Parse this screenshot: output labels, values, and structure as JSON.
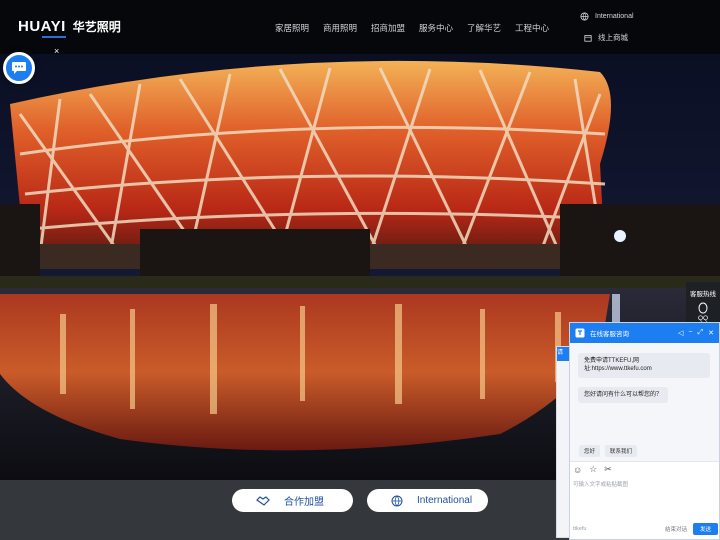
{
  "header": {
    "logo_latin": "HUAYI",
    "logo_cn": "华艺照明",
    "nav": [
      {
        "label": "家居照明"
      },
      {
        "label": "商用照明"
      },
      {
        "label": "招商加盟"
      },
      {
        "label": "服务中心"
      },
      {
        "label": "了解华艺"
      },
      {
        "label": "工程中心"
      }
    ],
    "international": "International",
    "shop": "线上商城"
  },
  "hero": {
    "close_mark": "×"
  },
  "bottom": {
    "join_label": "合作加盟",
    "intl_label": "International"
  },
  "side": {
    "hotline": "客服热线",
    "qq": "QQ"
  },
  "chat": {
    "title": "在线客服咨询",
    "welcome": "免费申请TTKEFU,网址:https://www.ttkefu.com",
    "greeting": "您好请问有什么可以帮您的？",
    "quick_replies": [
      "您好",
      "联系我们"
    ],
    "input_placeholder": "可输入文字或粘贴截图",
    "brand": "ttkefu",
    "end_label": "结束对话",
    "send_label": "发送",
    "back_strip": "请"
  },
  "colors": {
    "accent": "#1c7ef0",
    "header_bg": "#06070a",
    "bottom_bg": "#34383d"
  }
}
